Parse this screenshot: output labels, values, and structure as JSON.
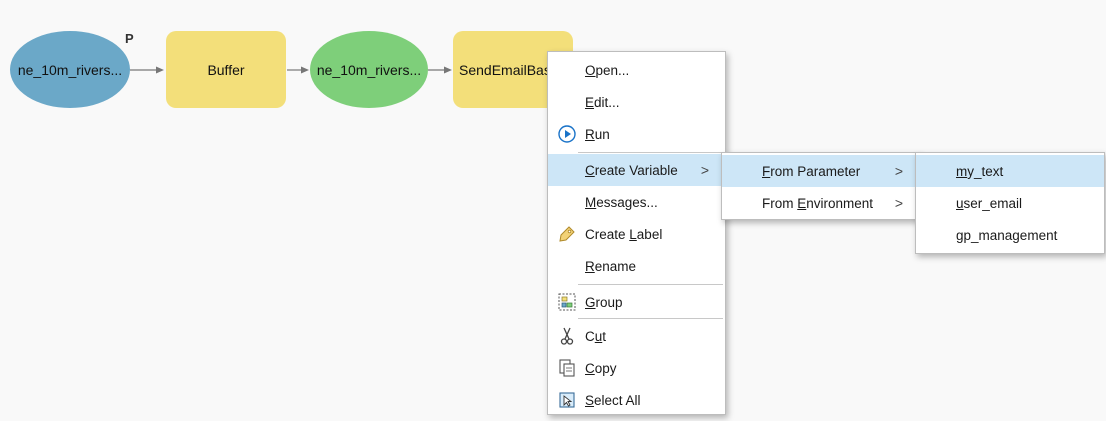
{
  "model": {
    "nodes": [
      {
        "label": "ne_10m_rivers...",
        "type": "input-data",
        "color": "#6ba8c8"
      },
      {
        "label": "Buffer",
        "type": "tool",
        "color": "#f3df7a"
      },
      {
        "label": "ne_10m_rivers...",
        "type": "output-data",
        "color": "#7ecf7a"
      },
      {
        "label": "SendEmailBas",
        "type": "tool",
        "color": "#f3df7a"
      }
    ],
    "parameter_marker": "P"
  },
  "context_menu": {
    "items": [
      {
        "key": "O",
        "rest": "pen..."
      },
      {
        "key": "E",
        "rest": "dit..."
      },
      {
        "key": "R",
        "rest": "un",
        "icon": "run-icon"
      },
      {
        "key": "C",
        "rest": "reate Variable",
        "submenu": true
      },
      {
        "key": "M",
        "rest": "essages..."
      },
      {
        "pre": "Create ",
        "key": "L",
        "rest": "abel",
        "icon": "label-icon"
      },
      {
        "key": "R",
        "rest": "ename"
      },
      {
        "key": "G",
        "rest": "roup",
        "icon": "group-icon"
      },
      {
        "pre": "C",
        "key": "u",
        "rest": "t",
        "icon": "cut-icon"
      },
      {
        "key": "C",
        "rest": "opy",
        "icon": "copy-icon"
      },
      {
        "key": "S",
        "rest": "elect All",
        "icon": "select-all-icon"
      }
    ],
    "submenu_arrow": ">"
  },
  "variable_submenu": {
    "items": [
      {
        "key": "F",
        "rest": "rom Parameter"
      },
      {
        "pre": "From ",
        "key": "E",
        "rest": "nvironment"
      }
    ]
  },
  "parameter_submenu": {
    "items": [
      {
        "key": "m",
        "rest": "y_text"
      },
      {
        "key": "u",
        "rest": "ser_email"
      },
      {
        "key": "g",
        "rest": "p_management"
      }
    ]
  },
  "colors": {
    "highlight": "#cde6f7",
    "run_icon": "#1a73c8"
  }
}
